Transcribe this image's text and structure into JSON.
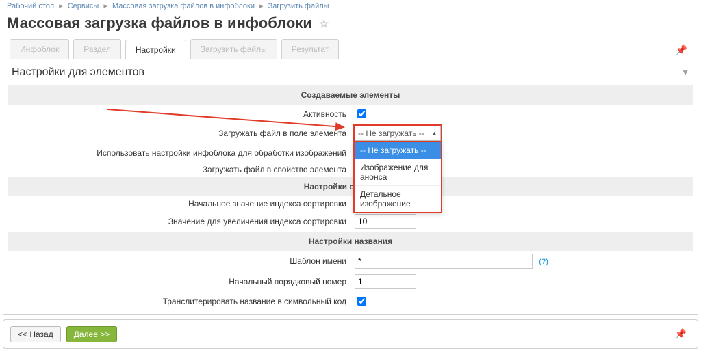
{
  "breadcrumbs": {
    "items": [
      "Рабочий стол",
      "Сервисы",
      "Массовая загрузка файлов в инфоблоки",
      "Загрузить файлы"
    ]
  },
  "page_title": "Массовая загрузка файлов в инфоблоки",
  "tabs": {
    "items": [
      {
        "label": "Инфоблок",
        "state": "disabled"
      },
      {
        "label": "Раздел",
        "state": "disabled"
      },
      {
        "label": "Настройки",
        "state": "active"
      },
      {
        "label": "Загрузить файлы",
        "state": "disabled"
      },
      {
        "label": "Результат",
        "state": "disabled"
      }
    ]
  },
  "panel": {
    "title": "Настройки для элементов"
  },
  "sections": {
    "s1": "Создаваемые элементы",
    "s2": "Настройки сортировки",
    "s3": "Настройки названия"
  },
  "labels": {
    "active": "Активность",
    "upload_to_field": "Загружать файл в поле элемента",
    "use_iblock_settings": "Использовать настройки инфоблока для обработки изображений",
    "upload_to_property": "Загружать файл в свойство элемента",
    "sort_start": "Начальное значение индекса сортировки",
    "sort_step": "Значение для увеличения индекса сортировки",
    "name_template": "Шаблон имени",
    "name_start_num": "Начальный порядковый номер",
    "translit": "Транслитерировать название в символьный код"
  },
  "fields": {
    "upload_to_field": {
      "selected": "-- Не загружать --",
      "options": [
        "-- Не загружать --",
        "Изображение для анонса",
        "Детальное изображение"
      ],
      "highlighted_index": 0
    },
    "sort_step": "10",
    "name_template": "*",
    "name_start_num": "1"
  },
  "footer": {
    "back": "<< Назад",
    "next": "Далее >>"
  },
  "help_marker": "(?)"
}
